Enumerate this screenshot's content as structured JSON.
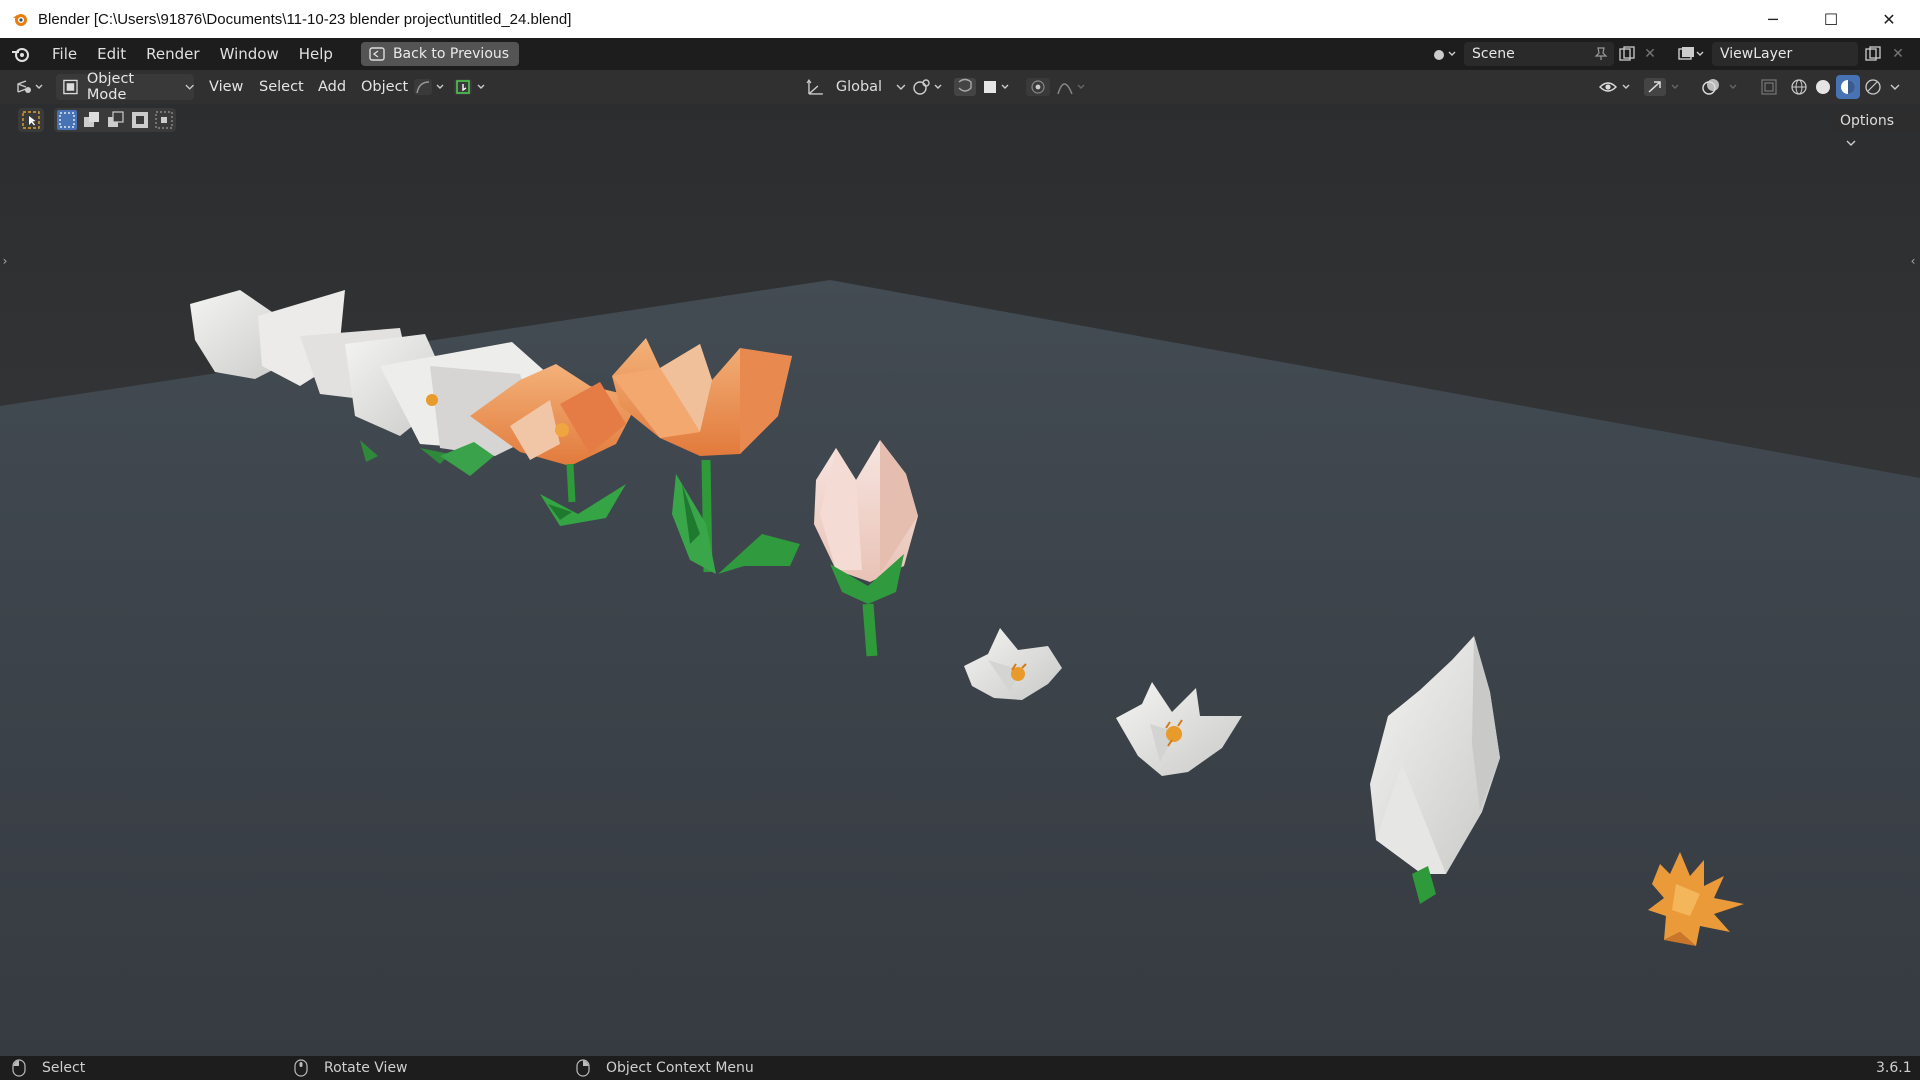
{
  "window": {
    "title": "Blender [C:\\Users\\91876\\Documents\\11-10-23 blender project\\untitled_24.blend]",
    "controls": {
      "minimize": "─",
      "maximize": "☐",
      "close": "✕"
    }
  },
  "topbar": {
    "menus": [
      "File",
      "Edit",
      "Render",
      "Window",
      "Help"
    ],
    "back_button": "Back to Previous",
    "scene_name": "Scene",
    "view_layer": "ViewLayer"
  },
  "header": {
    "mode": "Object Mode",
    "menus": [
      "View",
      "Select",
      "Add",
      "Object"
    ],
    "transform_orientation": "Global"
  },
  "viewport": {
    "options_label": "Options",
    "shading_active": "solid",
    "colors": {
      "background": "#2f3134",
      "floor": "#3f454b",
      "white_petal": "#e8e8e6",
      "orange_petal": "#e8944f",
      "stem_green": "#2e9a3a",
      "center_yellow": "#e89a2a"
    }
  },
  "statusbar": {
    "select": "Select",
    "rotate": "Rotate View",
    "context": "Object Context Menu",
    "version": "3.6.1"
  }
}
